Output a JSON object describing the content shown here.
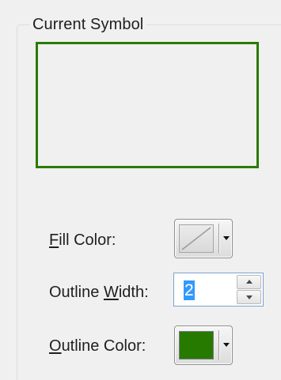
{
  "group": {
    "title": "Current Symbol"
  },
  "preview": {
    "outline_color": "#2a7a00"
  },
  "fill_color": {
    "label_mnemonic": "F",
    "label_rest": "ill Color:",
    "value": "none",
    "icon": "no-fill-icon"
  },
  "outline_width": {
    "label_before": "Outline ",
    "label_mnemonic": "W",
    "label_rest": "idth:",
    "value": "2"
  },
  "outline_color": {
    "label_mnemonic": "O",
    "label_rest": "utline Color:",
    "value": "#267a00"
  }
}
